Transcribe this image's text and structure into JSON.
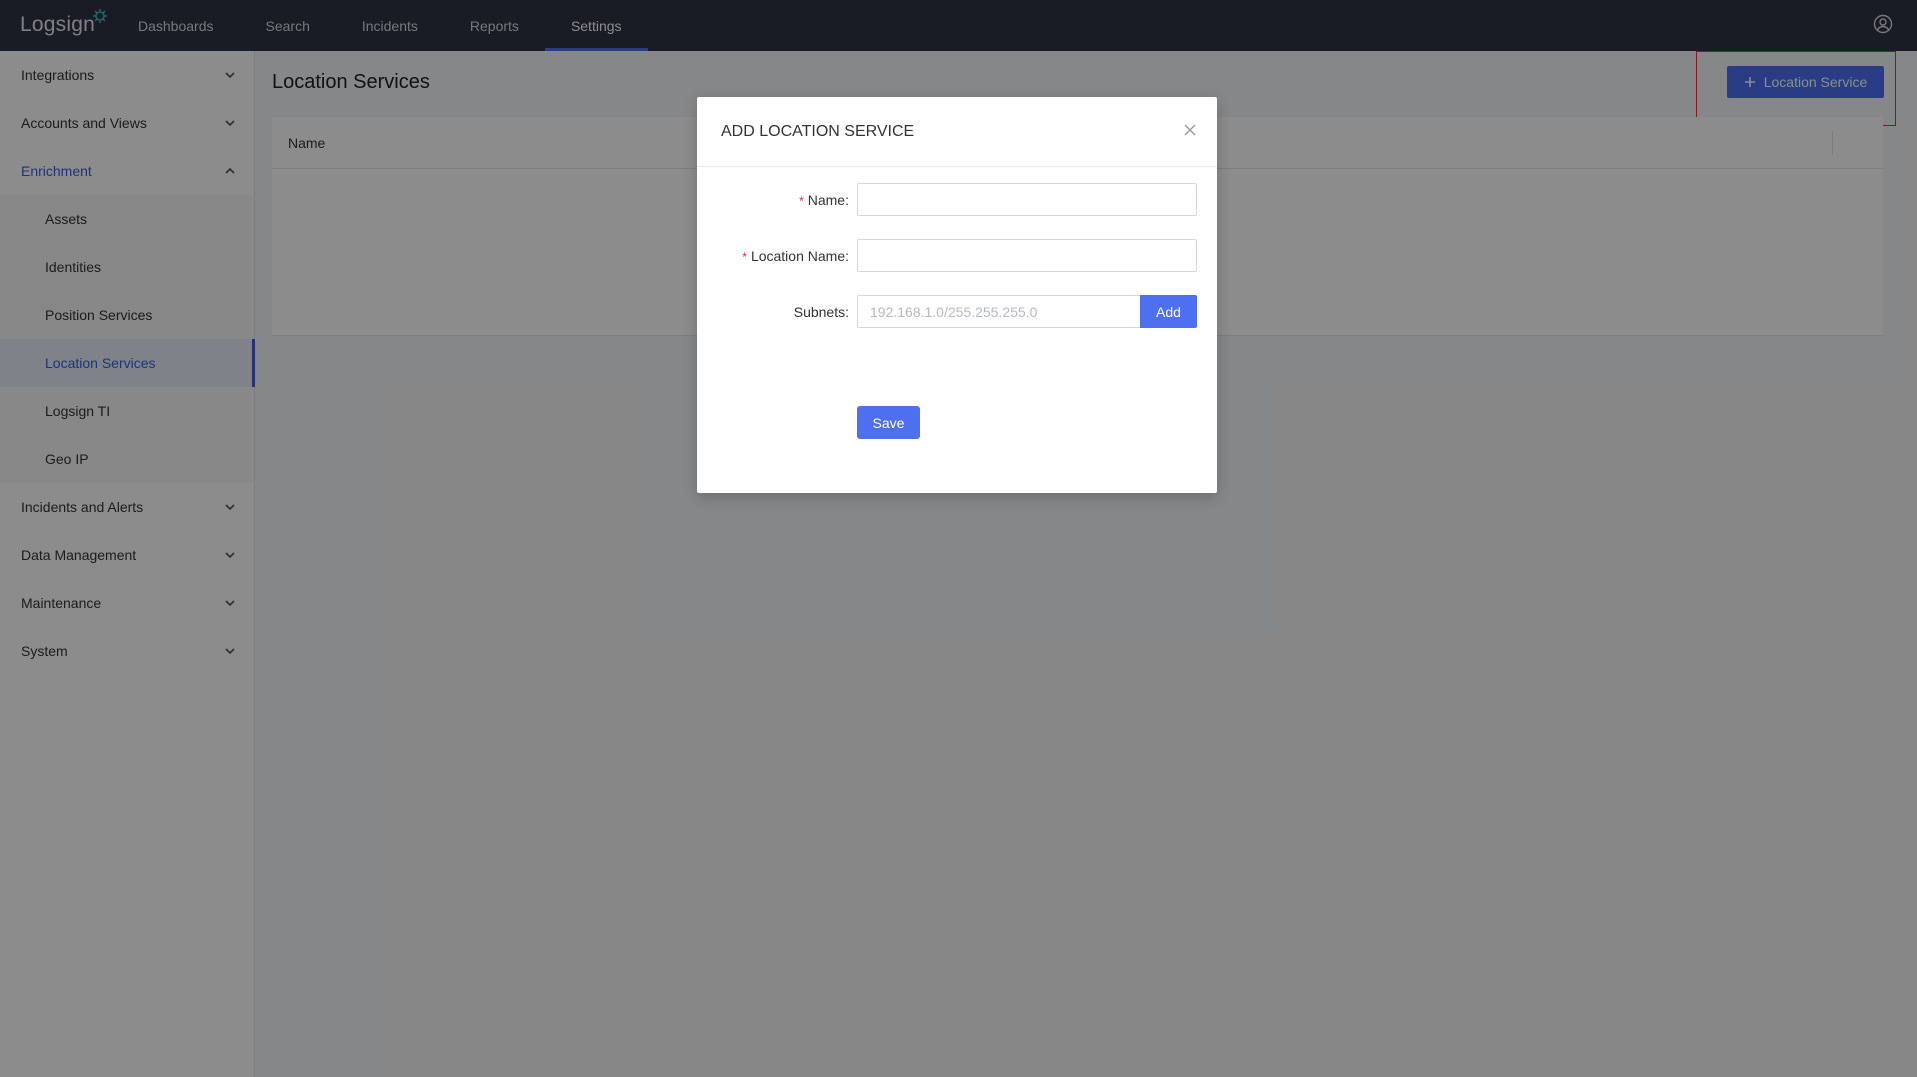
{
  "topbar": {
    "logo": "Logsign",
    "nav": [
      {
        "label": "Dashboards"
      },
      {
        "label": "Search"
      },
      {
        "label": "Incidents"
      },
      {
        "label": "Reports"
      },
      {
        "label": "Settings"
      }
    ],
    "active_nav": "Settings",
    "user_icon": "user-circle-icon"
  },
  "sidebar": {
    "items": [
      {
        "label": "Integrations"
      },
      {
        "label": "Accounts and Views"
      },
      {
        "label": "Enrichment"
      },
      {
        "label": "Incidents and Alerts"
      },
      {
        "label": "Data Management"
      },
      {
        "label": "Maintenance"
      },
      {
        "label": "System"
      }
    ],
    "enrichment_children": [
      {
        "label": "Assets"
      },
      {
        "label": "Identities"
      },
      {
        "label": "Position Services"
      },
      {
        "label": "Location Services"
      },
      {
        "label": "Logsign TI"
      },
      {
        "label": "Geo IP"
      }
    ],
    "active_child": "Location Services"
  },
  "main": {
    "title": "Location Services",
    "add_button_label": "Location Service",
    "table": {
      "columns": [
        "Name"
      ]
    }
  },
  "modal": {
    "title": "ADD LOCATION SERVICE",
    "fields": {
      "name_label": "Name",
      "name_value": "",
      "location_name_label": "Location Name",
      "location_name_value": "",
      "subnets_label": "Subnets",
      "subnets_placeholder": "192.168.1.0/255.255.255.0"
    },
    "subnet_add_label": "Add",
    "save_label": "Save"
  },
  "colors": {
    "topbar": "#2f3244",
    "accent": "#4d6ff0",
    "required": "#f5222d",
    "highlight": "#ff2a2a"
  }
}
